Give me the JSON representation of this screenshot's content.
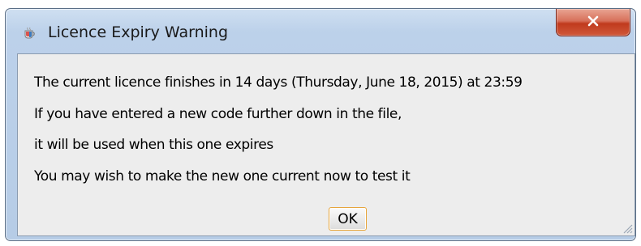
{
  "window": {
    "title": "Licence Expiry Warning",
    "app_icon": "java-cup-icon",
    "close_icon": "close-icon"
  },
  "messages": [
    "The current licence finishes in 14 days (Thursday, June 18, 2015) at 23:59",
    "If you have entered a new code further down in the file,",
    "it will be used when this one expires",
    "You may wish to make the new one current now to test it"
  ],
  "buttons": {
    "ok_label": "OK"
  },
  "colors": {
    "close_button": "#c8452a",
    "ok_focus_border": "#e7a53a",
    "client_background": "#ededed",
    "frame": "#bcd1ea"
  }
}
